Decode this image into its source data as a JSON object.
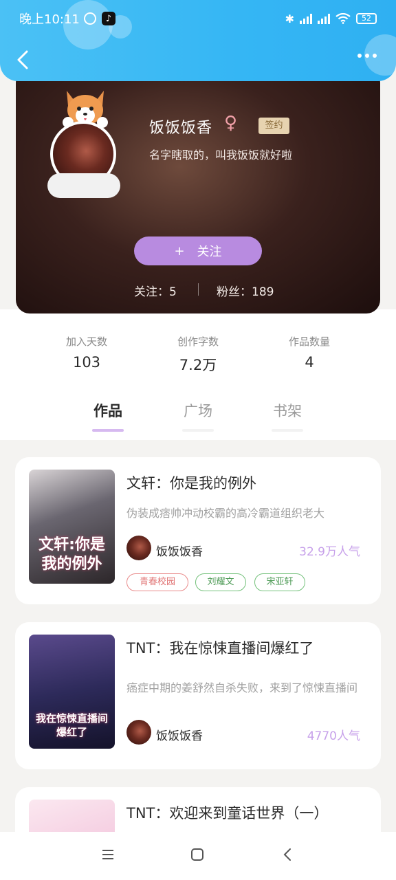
{
  "status_bar": {
    "time": "晚上10:11",
    "battery": "52"
  },
  "profile": {
    "name": "饭饭饭香",
    "gender_symbol": "♀",
    "sign_badge": "签约",
    "bio": "名字瞎取的，叫我饭饭就好啦",
    "follow_plus": "+",
    "follow_label": "关注",
    "following_text": "关注：5",
    "followers_text": "粉丝：189"
  },
  "stats": [
    {
      "label": "加入天数",
      "value": "103"
    },
    {
      "label": "创作字数",
      "value": "7.2万"
    },
    {
      "label": "作品数量",
      "value": "4"
    }
  ],
  "tabs": [
    {
      "label": "作品",
      "active": true
    },
    {
      "label": "广场",
      "active": false
    },
    {
      "label": "书架",
      "active": false
    }
  ],
  "books": [
    {
      "title": "文轩：你是我的例外",
      "description": "伪装成痞帅冲动校霸的高冷霸道组织老大",
      "author": "饭饭饭香",
      "popularity": "32.9万人气",
      "cover_text": "文轩:你是我的例外",
      "tags": [
        "青春校园",
        "刘耀文",
        "宋亚轩"
      ]
    },
    {
      "title": "TNT：我在惊悚直播间爆红了",
      "description": "癌症中期的姜舒然自杀失败，来到了惊悚直播间",
      "author": "饭饭饭香",
      "popularity": "4770人气",
      "cover_text": "我在惊悚直播间爆红了"
    },
    {
      "title": "TNT：欢迎来到童话世界（一）"
    }
  ],
  "colors": {
    "header": "#35b6f4",
    "accent_purple": "#b88be0",
    "popularity": "#c7a1ea"
  }
}
